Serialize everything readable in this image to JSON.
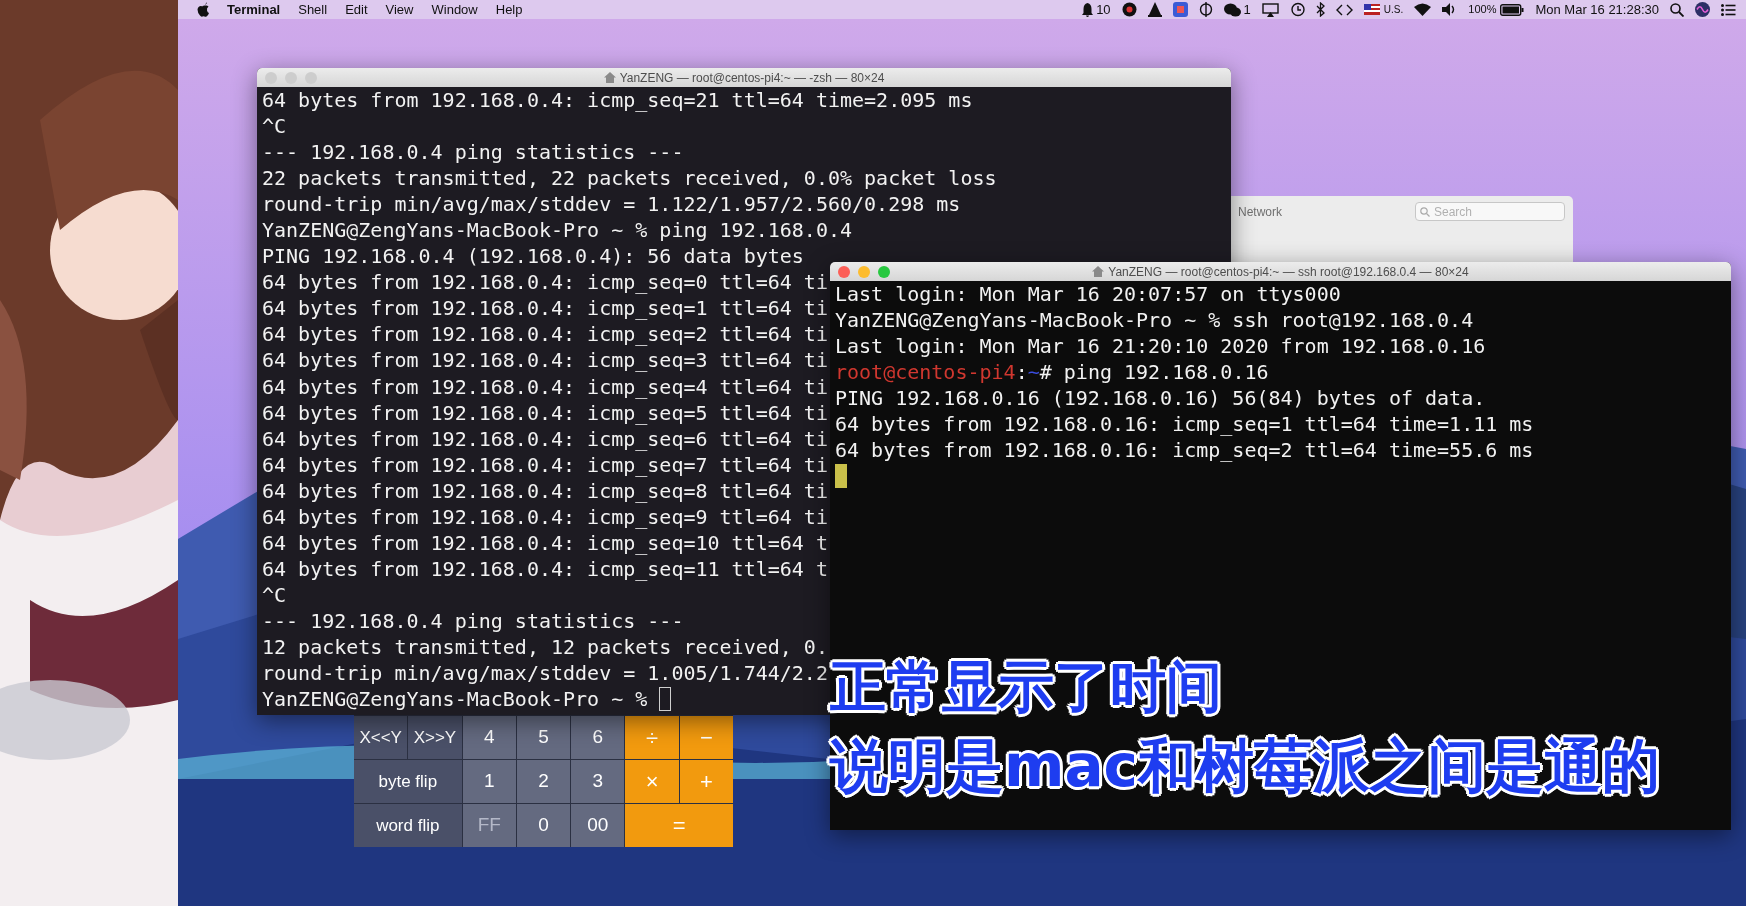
{
  "menu_bar": {
    "app_name": "Terminal",
    "menus": [
      "Shell",
      "Edit",
      "View",
      "Window",
      "Help"
    ],
    "status": {
      "notification_count": "10",
      "chat_count": "1",
      "input_source": "U.S.",
      "battery": "100%",
      "clock": "Mon Mar 16 21:28:30"
    }
  },
  "network_window": {
    "title": "Network",
    "search_placeholder": "Search"
  },
  "terminals": [
    {
      "title": "YanZENG — root@centos-pi4:~ — -zsh — 80×24",
      "active": false,
      "lines": [
        {
          "text": "64 bytes from 192.168.0.4: icmp_seq=21 ttl=64 time=2.095 ms"
        },
        {
          "text": "^C"
        },
        {
          "text": "--- 192.168.0.4 ping statistics ---"
        },
        {
          "text": "22 packets transmitted, 22 packets received, 0.0% packet loss"
        },
        {
          "text": "round-trip min/avg/max/stddev = 1.122/1.957/2.560/0.298 ms"
        },
        {
          "text": "YanZENG@ZengYans-MacBook-Pro ~ % ping 192.168.0.4"
        },
        {
          "text": "PING 192.168.0.4 (192.168.0.4): 56 data bytes"
        },
        {
          "text": "64 bytes from 192.168.0.4: icmp_seq=0 ttl=64 ti"
        },
        {
          "text": "64 bytes from 192.168.0.4: icmp_seq=1 ttl=64 ti"
        },
        {
          "text": "64 bytes from 192.168.0.4: icmp_seq=2 ttl=64 ti"
        },
        {
          "text": "64 bytes from 192.168.0.4: icmp_seq=3 ttl=64 ti"
        },
        {
          "text": "64 bytes from 192.168.0.4: icmp_seq=4 ttl=64 ti"
        },
        {
          "text": "64 bytes from 192.168.0.4: icmp_seq=5 ttl=64 ti"
        },
        {
          "text": "64 bytes from 192.168.0.4: icmp_seq=6 ttl=64 ti"
        },
        {
          "text": "64 bytes from 192.168.0.4: icmp_seq=7 ttl=64 ti"
        },
        {
          "text": "64 bytes from 192.168.0.4: icmp_seq=8 ttl=64 ti"
        },
        {
          "text": "64 bytes from 192.168.0.4: icmp_seq=9 ttl=64 ti"
        },
        {
          "text": "64 bytes from 192.168.0.4: icmp_seq=10 ttl=64 t"
        },
        {
          "text": "64 bytes from 192.168.0.4: icmp_seq=11 ttl=64 t"
        },
        {
          "text": "^C"
        },
        {
          "text": "--- 192.168.0.4 ping statistics ---"
        },
        {
          "text": "12 packets transmitted, 12 packets received, 0."
        },
        {
          "text": "round-trip min/avg/max/stddev = 1.005/1.744/2.2"
        },
        {
          "text": "YanZENG@ZengYans-MacBook-Pro ~ %",
          "cursor": true
        }
      ]
    },
    {
      "title": "YanZENG — root@centos-pi4:~ — ssh root@192.168.0.4 — 80×24",
      "active": true,
      "lines": [
        {
          "text": "Last login: Mon Mar 16 20:07:57 on ttys000"
        },
        {
          "text": "YanZENG@ZengYans-MacBook-Pro ~ % ssh root@192.168.0.4"
        },
        {
          "text": "Last login: Mon Mar 16 21:20:10 2020 from 192.168.0.16"
        },
        {
          "segments": [
            {
              "text": "root@centos-pi4",
              "kind": "host"
            },
            {
              "text": ":",
              "kind": "plain"
            },
            {
              "text": "~",
              "kind": "path"
            },
            {
              "text": "# ping 192.168.0.16",
              "kind": "plain"
            }
          ]
        },
        {
          "text": "PING 192.168.0.16 (192.168.0.16) 56(84) bytes of data."
        },
        {
          "text": "64 bytes from 192.168.0.16: icmp_seq=1 ttl=64 time=1.11 ms"
        },
        {
          "text": "64 bytes from 192.168.0.16: icmp_seq=2 ttl=64 time=55.6 ms"
        },
        {
          "cursor": true
        }
      ]
    }
  ],
  "calculator": {
    "rows": [
      [
        {
          "label": "X<<Y",
          "kind": "function"
        },
        {
          "label": "X>>Y",
          "kind": "function"
        },
        {
          "label": "4",
          "kind": "digit"
        },
        {
          "label": "5",
          "kind": "digit"
        },
        {
          "label": "6",
          "kind": "digit"
        },
        {
          "label": "÷",
          "kind": "operator"
        },
        {
          "label": "−",
          "kind": "operator"
        }
      ],
      [
        {
          "label": "byte flip",
          "kind": "function",
          "colspan": 2
        },
        {
          "label": "1",
          "kind": "digit"
        },
        {
          "label": "2",
          "kind": "digit"
        },
        {
          "label": "3",
          "kind": "digit"
        },
        {
          "label": "×",
          "kind": "operator"
        },
        {
          "label": "+",
          "kind": "operator"
        }
      ],
      [
        {
          "label": "word flip",
          "kind": "function",
          "colspan": 2
        },
        {
          "label": "FF",
          "kind": "digit",
          "disabled": true
        },
        {
          "label": "0",
          "kind": "digit"
        },
        {
          "label": "00",
          "kind": "digit"
        },
        {
          "label": "=",
          "kind": "operator",
          "colspan": 2
        }
      ]
    ]
  },
  "subtitles": [
    "正常显示了时间",
    "说明是mac和树莓派之间是通的"
  ]
}
